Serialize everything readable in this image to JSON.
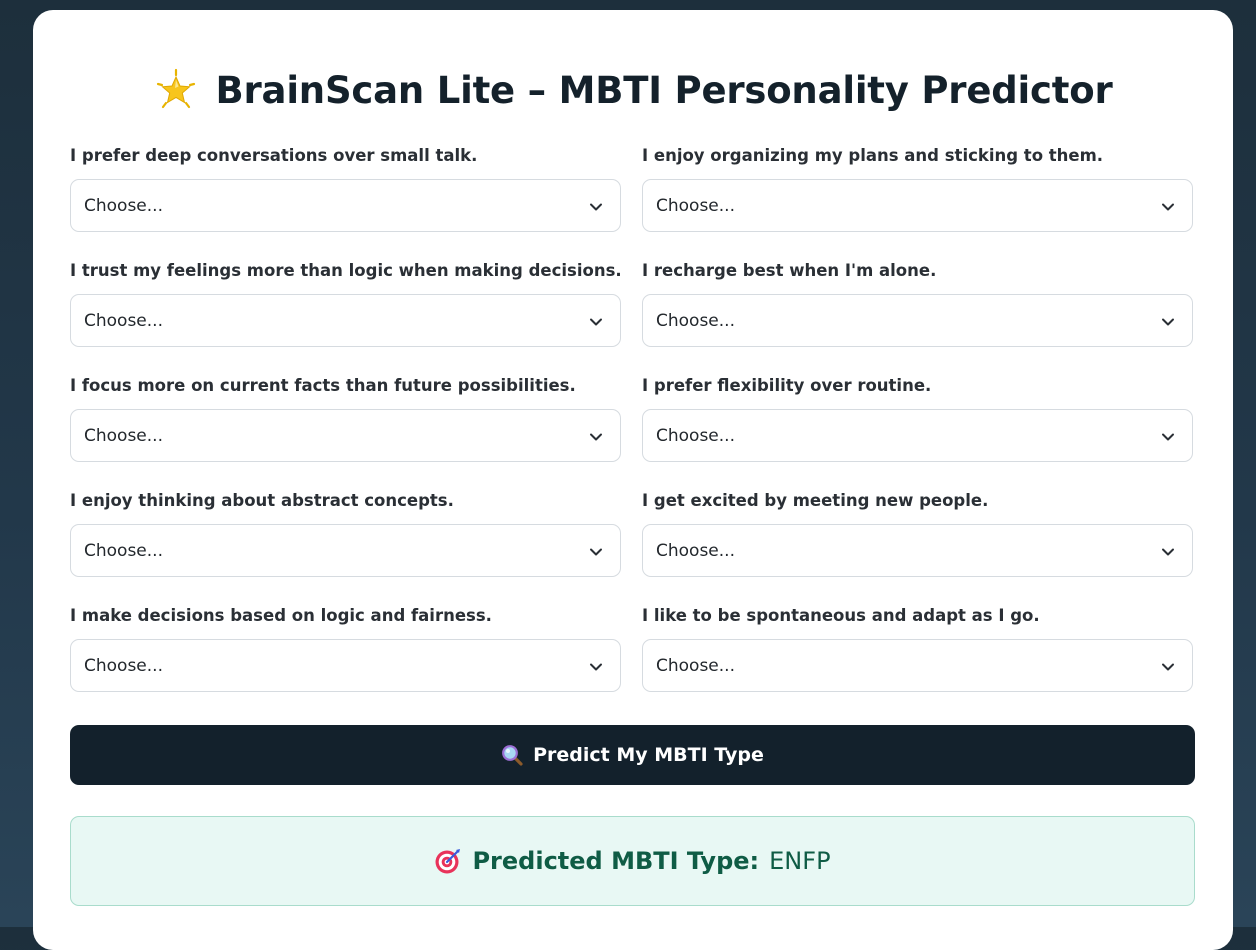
{
  "header": {
    "icon": "glowing-star-icon",
    "title": "BrainScan Lite – MBTI Personality Predictor"
  },
  "questions": [
    {
      "label": "I prefer deep conversations over small talk.",
      "value": "Choose..."
    },
    {
      "label": "I enjoy organizing my plans and sticking to them.",
      "value": "Choose..."
    },
    {
      "label": "I trust my feelings more than logic when making decisions.",
      "value": "Choose..."
    },
    {
      "label": "I recharge best when I'm alone.",
      "value": "Choose..."
    },
    {
      "label": "I focus more on current facts than future possibilities.",
      "value": "Choose..."
    },
    {
      "label": "I prefer flexibility over routine.",
      "value": "Choose..."
    },
    {
      "label": "I enjoy thinking about abstract concepts.",
      "value": "Choose..."
    },
    {
      "label": "I get excited by meeting new people.",
      "value": "Choose..."
    },
    {
      "label": "I make decisions based on logic and fairness.",
      "value": "Choose..."
    },
    {
      "label": "I like to be spontaneous and adapt as I go.",
      "value": "Choose..."
    }
  ],
  "predict_button": {
    "icon": "magnifying-glass-icon",
    "label": "Predict My MBTI Type"
  },
  "result": {
    "icon": "target-icon",
    "label": "Predicted MBTI Type:",
    "value": "ENFP"
  },
  "colors": {
    "page_background": "#1d2f3c",
    "card_background": "#ffffff",
    "title_text": "#14212b",
    "button_background": "#13212c",
    "result_background": "#e8f8f4",
    "result_border": "#a9dccc",
    "result_text": "#0f5c45"
  }
}
